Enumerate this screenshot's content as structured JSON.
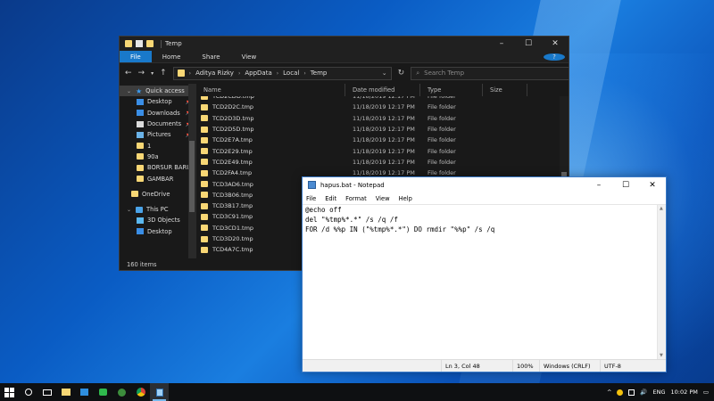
{
  "explorer": {
    "title": "Temp",
    "ribbon": [
      "File",
      "Home",
      "Share",
      "View"
    ],
    "help": "?",
    "breadcrumb": [
      "Aditya Rizky",
      "AppData",
      "Local",
      "Temp"
    ],
    "search_placeholder": "Search Temp",
    "columns": [
      "Name",
      "Date modified",
      "Type",
      "Size"
    ],
    "nav": [
      {
        "label": "Quick access",
        "icon": "star-icon"
      },
      {
        "label": "Desktop",
        "icon": "desktop-icon",
        "pinned": true
      },
      {
        "label": "Downloads",
        "icon": "downloads-icon",
        "pinned": true
      },
      {
        "label": "Documents",
        "icon": "documents-icon",
        "pinned": true
      },
      {
        "label": "Pictures",
        "icon": "pictures-icon",
        "pinned": true
      },
      {
        "label": "1",
        "icon": "folder-icon"
      },
      {
        "label": "90a",
        "icon": "folder-icon"
      },
      {
        "label": "BORSUR BARU",
        "icon": "folder-icon"
      },
      {
        "label": "GAMBAR",
        "icon": "folder-icon"
      },
      {
        "label": "OneDrive",
        "icon": "folder-icon"
      },
      {
        "label": "This PC",
        "icon": "pc-icon"
      },
      {
        "label": "3D Objects",
        "icon": "3d-objects-icon"
      },
      {
        "label": "Desktop",
        "icon": "desktop-icon"
      }
    ],
    "files": [
      {
        "name": "TCD2CDD.tmp",
        "date": "11/18/2019 12:17 PM",
        "type": "File folder"
      },
      {
        "name": "TCD2D2C.tmp",
        "date": "11/18/2019 12:17 PM",
        "type": "File folder"
      },
      {
        "name": "TCD2D3D.tmp",
        "date": "11/18/2019 12:17 PM",
        "type": "File folder"
      },
      {
        "name": "TCD2D5D.tmp",
        "date": "11/18/2019 12:17 PM",
        "type": "File folder"
      },
      {
        "name": "TCD2E7A.tmp",
        "date": "11/18/2019 12:17 PM",
        "type": "File folder"
      },
      {
        "name": "TCD2E29.tmp",
        "date": "11/18/2019 12:17 PM",
        "type": "File folder"
      },
      {
        "name": "TCD2E49.tmp",
        "date": "11/18/2019 12:17 PM",
        "type": "File folder"
      },
      {
        "name": "TCD2FA4.tmp",
        "date": "11/18/2019 12:17 PM",
        "type": "File folder"
      },
      {
        "name": "TCD3AD6.tmp",
        "date": "",
        "type": ""
      },
      {
        "name": "TCD3B06.tmp",
        "date": "",
        "type": ""
      },
      {
        "name": "TCD3B17.tmp",
        "date": "",
        "type": ""
      },
      {
        "name": "TCD3C91.tmp",
        "date": "",
        "type": ""
      },
      {
        "name": "TCD3CD1.tmp",
        "date": "",
        "type": ""
      },
      {
        "name": "TCD3D20.tmp",
        "date": "",
        "type": ""
      },
      {
        "name": "TCD4A7C.tmp",
        "date": "",
        "type": ""
      }
    ],
    "status": "160 items"
  },
  "notepad": {
    "title": "hapus.bat - Notepad",
    "menu": [
      "File",
      "Edit",
      "Format",
      "View",
      "Help"
    ],
    "content": "@echo off\ndel \"%tmp%*.*\" /s /q /f\nFOR /d %%p IN (\"%tmp%*.*\") DO rmdir \"%%p\" /s /q",
    "status": {
      "position": "Ln 3, Col 48",
      "zoom": "100%",
      "eol": "Windows (CRLF)",
      "encoding": "UTF-8"
    }
  },
  "taskbar": {
    "time": "10:02 PM",
    "lang": "ENG"
  },
  "colors": {
    "accent": "#1979ca",
    "folder": "#f8d775",
    "explorer_bg": "#191919",
    "taskbar_bg": "#0e1012"
  }
}
